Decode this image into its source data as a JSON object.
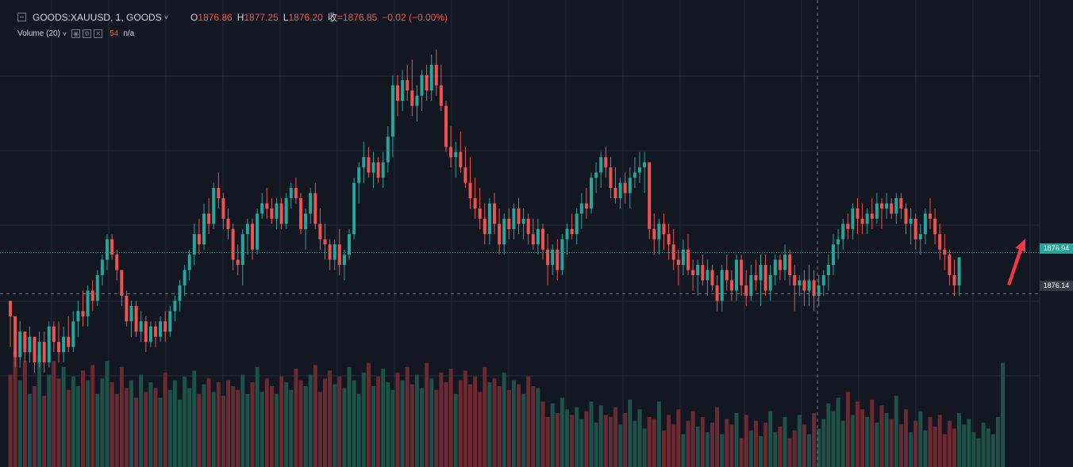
{
  "legend": {
    "symbol": "GOODS:XAUUSD, 1, GOODS",
    "caret": "˅",
    "open_label": "O",
    "open": "1876.86",
    "high_label": "H",
    "high": "1877.25",
    "low_label": "L",
    "low": "1876.20",
    "close_label": "收",
    "close": "=1876.85",
    "change": "−0.02 (−0.00%)",
    "volume_label": "Volume (20)",
    "volume_value": "54",
    "volume_ma": "n/a"
  },
  "price_axis": {
    "last_price": "1876.94",
    "crosshair_price": "1876.14"
  },
  "colors": {
    "background": "#131722",
    "up": "#26a69a",
    "down": "#ef5350",
    "grid": "#2a2e39",
    "arrow": "#f23645"
  },
  "chart_data": {
    "type": "candlestick",
    "symbol": "GOODS:XAUUSD",
    "interval": "1",
    "ylim": [
      1874.6,
      1881.4
    ],
    "volume_ylim": [
      0,
      70
    ],
    "last_price": 1876.94,
    "crosshair_price": 1876.14,
    "candles": [
      [
        1876.0,
        1876.0,
        1875.1,
        1875.7
      ],
      [
        1875.7,
        1875.7,
        1874.7,
        1874.9
      ],
      [
        1874.9,
        1875.6,
        1874.7,
        1875.4
      ],
      [
        1875.4,
        1875.4,
        1874.8,
        1875.0
      ],
      [
        1875.0,
        1875.5,
        1874.8,
        1875.3
      ],
      [
        1875.3,
        1875.3,
        1874.6,
        1874.8
      ],
      [
        1874.8,
        1875.4,
        1874.7,
        1875.2
      ],
      [
        1875.2,
        1875.4,
        1874.6,
        1874.8
      ],
      [
        1874.8,
        1875.6,
        1874.7,
        1875.5
      ],
      [
        1875.5,
        1875.6,
        1875.0,
        1875.2
      ],
      [
        1875.2,
        1875.6,
        1874.8,
        1875.0
      ],
      [
        1875.0,
        1875.5,
        1874.8,
        1875.3
      ],
      [
        1875.3,
        1875.7,
        1875.0,
        1875.1
      ],
      [
        1875.1,
        1875.8,
        1875.0,
        1875.6
      ],
      [
        1875.6,
        1876.0,
        1875.3,
        1875.8
      ],
      [
        1875.8,
        1876.2,
        1875.5,
        1875.7
      ],
      [
        1875.7,
        1876.3,
        1875.5,
        1876.2
      ],
      [
        1876.2,
        1876.4,
        1875.8,
        1876.0
      ],
      [
        1876.0,
        1876.6,
        1875.9,
        1876.5
      ],
      [
        1876.5,
        1876.9,
        1876.3,
        1876.8
      ],
      [
        1876.8,
        1877.3,
        1876.6,
        1877.2
      ],
      [
        1877.2,
        1877.3,
        1876.8,
        1876.9
      ],
      [
        1876.9,
        1877.0,
        1876.4,
        1876.6
      ],
      [
        1876.6,
        1876.6,
        1875.9,
        1876.1
      ],
      [
        1876.1,
        1876.2,
        1875.5,
        1875.6
      ],
      [
        1875.6,
        1876.0,
        1875.3,
        1875.9
      ],
      [
        1875.9,
        1876.0,
        1875.3,
        1875.4
      ],
      [
        1875.4,
        1875.8,
        1875.2,
        1875.6
      ],
      [
        1875.6,
        1875.7,
        1875.0,
        1875.2
      ],
      [
        1875.2,
        1875.6,
        1875.1,
        1875.5
      ],
      [
        1875.5,
        1875.6,
        1875.1,
        1875.3
      ],
      [
        1875.3,
        1875.7,
        1875.2,
        1875.6
      ],
      [
        1875.6,
        1875.8,
        1875.2,
        1875.4
      ],
      [
        1875.4,
        1875.9,
        1875.3,
        1875.8
      ],
      [
        1875.8,
        1876.1,
        1875.6,
        1876.0
      ],
      [
        1876.0,
        1876.4,
        1875.8,
        1876.3
      ],
      [
        1876.3,
        1876.7,
        1876.1,
        1876.6
      ],
      [
        1876.6,
        1877.0,
        1876.4,
        1876.9
      ],
      [
        1876.9,
        1877.5,
        1876.7,
        1877.3
      ],
      [
        1877.3,
        1877.6,
        1876.9,
        1877.1
      ],
      [
        1877.1,
        1877.9,
        1877.0,
        1877.7
      ],
      [
        1877.7,
        1878.0,
        1877.3,
        1877.5
      ],
      [
        1877.5,
        1878.3,
        1877.4,
        1878.2
      ],
      [
        1878.2,
        1878.5,
        1877.8,
        1878.0
      ],
      [
        1878.0,
        1878.1,
        1877.4,
        1877.6
      ],
      [
        1877.6,
        1877.8,
        1877.2,
        1877.4
      ],
      [
        1877.4,
        1877.5,
        1876.6,
        1876.8
      ],
      [
        1876.8,
        1877.1,
        1876.5,
        1876.7
      ],
      [
        1876.7,
        1877.4,
        1876.3,
        1877.3
      ],
      [
        1877.3,
        1877.6,
        1876.9,
        1877.5
      ],
      [
        1877.5,
        1877.6,
        1876.8,
        1877.0
      ],
      [
        1877.0,
        1877.8,
        1876.9,
        1877.7
      ],
      [
        1877.7,
        1878.1,
        1877.6,
        1877.9
      ],
      [
        1877.9,
        1878.2,
        1877.6,
        1877.8
      ],
      [
        1877.8,
        1878.0,
        1877.5,
        1877.6
      ],
      [
        1877.6,
        1878.0,
        1877.4,
        1877.9
      ],
      [
        1877.9,
        1878.0,
        1877.4,
        1877.5
      ],
      [
        1877.5,
        1878.1,
        1877.4,
        1878.0
      ],
      [
        1878.0,
        1878.3,
        1877.8,
        1878.2
      ],
      [
        1878.2,
        1878.4,
        1877.9,
        1878.0
      ],
      [
        1878.0,
        1878.1,
        1877.3,
        1877.4
      ],
      [
        1877.4,
        1877.8,
        1877.0,
        1877.7
      ],
      [
        1877.7,
        1878.2,
        1877.5,
        1878.1
      ],
      [
        1878.1,
        1878.3,
        1877.4,
        1877.5
      ],
      [
        1877.5,
        1877.8,
        1877.0,
        1877.2
      ],
      [
        1877.2,
        1877.5,
        1876.8,
        1877.1
      ],
      [
        1877.1,
        1877.2,
        1876.6,
        1876.8
      ],
      [
        1876.8,
        1877.2,
        1876.6,
        1877.1
      ],
      [
        1877.1,
        1877.4,
        1876.5,
        1876.7
      ],
      [
        1876.7,
        1877.0,
        1876.4,
        1876.9
      ],
      [
        1876.9,
        1877.4,
        1876.8,
        1877.3
      ],
      [
        1877.3,
        1878.4,
        1877.2,
        1878.3
      ],
      [
        1878.3,
        1878.7,
        1877.9,
        1878.6
      ],
      [
        1878.6,
        1879.1,
        1878.3,
        1878.8
      ],
      [
        1878.8,
        1879.0,
        1878.4,
        1878.5
      ],
      [
        1878.5,
        1878.9,
        1878.2,
        1878.7
      ],
      [
        1878.7,
        1878.8,
        1878.3,
        1878.4
      ],
      [
        1878.4,
        1878.9,
        1878.2,
        1878.7
      ],
      [
        1878.7,
        1879.4,
        1878.5,
        1879.2
      ],
      [
        1879.2,
        1880.4,
        1878.8,
        1880.2
      ],
      [
        1880.2,
        1880.4,
        1879.6,
        1879.9
      ],
      [
        1879.9,
        1880.5,
        1879.7,
        1880.3
      ],
      [
        1880.3,
        1880.6,
        1879.9,
        1880.1
      ],
      [
        1880.1,
        1880.7,
        1879.6,
        1879.8
      ],
      [
        1879.8,
        1880.2,
        1879.5,
        1880.0
      ],
      [
        1880.0,
        1880.5,
        1879.7,
        1880.4
      ],
      [
        1880.4,
        1880.6,
        1879.9,
        1880.1
      ],
      [
        1880.1,
        1880.8,
        1879.9,
        1880.6
      ],
      [
        1880.6,
        1880.9,
        1880.0,
        1880.2
      ],
      [
        1880.2,
        1880.6,
        1879.7,
        1879.8
      ],
      [
        1879.8,
        1879.9,
        1878.9,
        1879.0
      ],
      [
        1879.0,
        1879.4,
        1878.6,
        1878.8
      ],
      [
        1878.8,
        1879.1,
        1878.4,
        1878.9
      ],
      [
        1878.9,
        1879.3,
        1878.5,
        1878.6
      ],
      [
        1878.6,
        1879.0,
        1878.2,
        1878.3
      ],
      [
        1878.3,
        1878.8,
        1877.8,
        1878.0
      ],
      [
        1878.0,
        1878.4,
        1877.6,
        1877.8
      ],
      [
        1877.8,
        1878.2,
        1877.4,
        1877.6
      ],
      [
        1877.6,
        1877.9,
        1877.1,
        1877.3
      ],
      [
        1877.3,
        1878.0,
        1877.1,
        1877.9
      ],
      [
        1877.9,
        1878.1,
        1877.3,
        1877.5
      ],
      [
        1877.5,
        1877.8,
        1876.9,
        1877.1
      ],
      [
        1877.1,
        1877.7,
        1876.9,
        1877.6
      ],
      [
        1877.6,
        1877.8,
        1877.2,
        1877.4
      ],
      [
        1877.4,
        1877.9,
        1877.2,
        1877.8
      ],
      [
        1877.8,
        1878.0,
        1877.3,
        1877.5
      ],
      [
        1877.5,
        1877.8,
        1877.2,
        1877.6
      ],
      [
        1877.6,
        1877.7,
        1877.1,
        1877.3
      ],
      [
        1877.3,
        1877.6,
        1877.0,
        1877.1
      ],
      [
        1877.1,
        1877.6,
        1876.9,
        1877.4
      ],
      [
        1877.4,
        1877.5,
        1876.8,
        1877.0
      ],
      [
        1877.0,
        1877.3,
        1876.3,
        1876.7
      ],
      [
        1876.7,
        1877.1,
        1876.5,
        1877.0
      ],
      [
        1877.0,
        1877.2,
        1876.4,
        1876.6
      ],
      [
        1876.6,
        1877.3,
        1876.5,
        1877.2
      ],
      [
        1877.2,
        1877.5,
        1876.9,
        1877.4
      ],
      [
        1877.4,
        1877.7,
        1877.2,
        1877.3
      ],
      [
        1877.3,
        1877.8,
        1877.1,
        1877.7
      ],
      [
        1877.7,
        1878.1,
        1877.4,
        1877.9
      ],
      [
        1877.9,
        1878.2,
        1877.6,
        1877.8
      ],
      [
        1877.8,
        1878.5,
        1877.7,
        1878.4
      ],
      [
        1878.4,
        1878.7,
        1878.1,
        1878.5
      ],
      [
        1878.5,
        1878.9,
        1878.2,
        1878.8
      ],
      [
        1878.8,
        1879.0,
        1878.4,
        1878.6
      ],
      [
        1878.6,
        1878.8,
        1878.0,
        1878.2
      ],
      [
        1878.2,
        1878.6,
        1877.9,
        1878.0
      ],
      [
        1878.0,
        1878.4,
        1877.8,
        1878.3
      ],
      [
        1878.3,
        1878.5,
        1877.9,
        1878.1
      ],
      [
        1878.1,
        1878.6,
        1877.8,
        1878.4
      ],
      [
        1878.4,
        1878.8,
        1878.2,
        1878.5
      ],
      [
        1878.5,
        1878.9,
        1878.3,
        1878.6
      ],
      [
        1878.6,
        1878.9,
        1878.1,
        1878.7
      ],
      [
        1878.7,
        1878.7,
        1877.2,
        1877.4
      ],
      [
        1877.4,
        1877.7,
        1876.9,
        1877.2
      ],
      [
        1877.2,
        1877.6,
        1876.9,
        1877.5
      ],
      [
        1877.5,
        1877.7,
        1877.0,
        1877.3
      ],
      [
        1877.3,
        1877.5,
        1876.8,
        1877.1
      ],
      [
        1877.1,
        1877.4,
        1876.6,
        1876.8
      ],
      [
        1876.8,
        1877.0,
        1876.3,
        1876.7
      ],
      [
        1876.7,
        1877.2,
        1876.5,
        1877.0
      ],
      [
        1877.0,
        1877.3,
        1876.5,
        1876.6
      ],
      [
        1876.6,
        1876.8,
        1876.2,
        1876.5
      ],
      [
        1876.5,
        1876.8,
        1876.1,
        1876.7
      ],
      [
        1876.7,
        1876.9,
        1876.3,
        1876.4
      ],
      [
        1876.4,
        1876.8,
        1876.1,
        1876.6
      ],
      [
        1876.6,
        1876.7,
        1876.2,
        1876.3
      ],
      [
        1876.3,
        1876.5,
        1875.8,
        1876.0
      ],
      [
        1876.0,
        1876.7,
        1875.8,
        1876.6
      ],
      [
        1876.6,
        1876.9,
        1876.2,
        1876.4
      ],
      [
        1876.4,
        1876.6,
        1876.0,
        1876.2
      ],
      [
        1876.2,
        1876.9,
        1876.0,
        1876.8
      ],
      [
        1876.8,
        1876.9,
        1876.1,
        1876.3
      ],
      [
        1876.3,
        1876.6,
        1875.9,
        1876.1
      ],
      [
        1876.1,
        1876.7,
        1876.0,
        1876.5
      ],
      [
        1876.5,
        1876.8,
        1876.2,
        1876.4
      ],
      [
        1876.4,
        1876.9,
        1875.9,
        1876.7
      ],
      [
        1876.7,
        1876.9,
        1876.1,
        1876.2
      ],
      [
        1876.2,
        1876.7,
        1876.0,
        1876.5
      ],
      [
        1876.5,
        1876.9,
        1876.3,
        1876.8
      ],
      [
        1876.8,
        1876.9,
        1876.4,
        1876.6
      ],
      [
        1876.6,
        1877.1,
        1876.4,
        1876.9
      ],
      [
        1876.9,
        1877.0,
        1876.3,
        1876.5
      ],
      [
        1876.5,
        1876.7,
        1875.8,
        1876.3
      ],
      [
        1876.3,
        1876.5,
        1876.1,
        1876.4
      ],
      [
        1876.4,
        1876.6,
        1875.9,
        1876.2
      ],
      [
        1876.2,
        1876.7,
        1875.9,
        1876.4
      ],
      [
        1876.4,
        1876.6,
        1875.8,
        1876.1
      ],
      [
        1876.1,
        1876.5,
        1875.9,
        1876.3
      ],
      [
        1876.3,
        1876.6,
        1876.1,
        1876.5
      ],
      [
        1876.5,
        1876.9,
        1876.2,
        1876.7
      ],
      [
        1876.7,
        1877.3,
        1876.5,
        1877.1
      ],
      [
        1877.1,
        1877.4,
        1876.8,
        1877.2
      ],
      [
        1877.2,
        1877.6,
        1877.0,
        1877.5
      ],
      [
        1877.5,
        1877.7,
        1877.2,
        1877.4
      ],
      [
        1877.4,
        1877.9,
        1877.2,
        1877.8
      ],
      [
        1877.8,
        1878.0,
        1877.3,
        1877.6
      ],
      [
        1877.6,
        1877.9,
        1877.3,
        1877.5
      ],
      [
        1877.5,
        1877.8,
        1877.3,
        1877.7
      ],
      [
        1877.7,
        1878.0,
        1877.4,
        1877.6
      ],
      [
        1877.6,
        1878.1,
        1877.5,
        1877.9
      ],
      [
        1877.9,
        1878.0,
        1877.4,
        1877.8
      ],
      [
        1877.8,
        1878.1,
        1877.6,
        1877.9
      ],
      [
        1877.9,
        1878.0,
        1877.6,
        1877.7
      ],
      [
        1877.7,
        1878.1,
        1877.5,
        1878.0
      ],
      [
        1878.0,
        1878.1,
        1877.6,
        1877.8
      ],
      [
        1877.8,
        1877.9,
        1877.3,
        1877.5
      ],
      [
        1877.5,
        1877.8,
        1877.1,
        1877.6
      ],
      [
        1877.6,
        1877.7,
        1877.0,
        1877.2
      ],
      [
        1877.2,
        1877.5,
        1876.9,
        1877.3
      ],
      [
        1877.3,
        1877.8,
        1877.1,
        1877.7
      ],
      [
        1877.7,
        1878.0,
        1877.4,
        1877.6
      ],
      [
        1877.6,
        1877.8,
        1877.1,
        1877.3
      ],
      [
        1877.3,
        1877.5,
        1876.8,
        1877.0
      ],
      [
        1877.0,
        1877.3,
        1876.6,
        1876.9
      ],
      [
        1876.9,
        1877.0,
        1876.3,
        1876.5
      ],
      [
        1876.5,
        1876.8,
        1876.1,
        1876.3
      ],
      [
        1876.3,
        1876.8,
        1876.1,
        1876.85
      ]
    ],
    "volumes": [
      48,
      60,
      45,
      55,
      38,
      42,
      58,
      37,
      48,
      55,
      46,
      52,
      40,
      47,
      42,
      50,
      45,
      53,
      38,
      46,
      55,
      44,
      38,
      52,
      41,
      45,
      36,
      48,
      39,
      44,
      41,
      36,
      49,
      40,
      45,
      35,
      47,
      41,
      50,
      38,
      43,
      46,
      39,
      44,
      37,
      45,
      42,
      40,
      48,
      38,
      44,
      52,
      39,
      46,
      42,
      38,
      47,
      44,
      40,
      51,
      45,
      42,
      48,
      53,
      39,
      46,
      50,
      43,
      47,
      41,
      52,
      45,
      38,
      49,
      54,
      42,
      47,
      51,
      44,
      40,
      49,
      45,
      52,
      43,
      48,
      41,
      54,
      46,
      40,
      49,
      44,
      51,
      38,
      45,
      50,
      43,
      47,
      39,
      52,
      44,
      46,
      42,
      49,
      40,
      45,
      43,
      38,
      47,
      42,
      41,
      34,
      26,
      33,
      28,
      36,
      30,
      27,
      31,
      25,
      29,
      34,
      23,
      32,
      27,
      26,
      31,
      22,
      28,
      35,
      24,
      30,
      20,
      26,
      25,
      34,
      19,
      27,
      22,
      30,
      17,
      24,
      29,
      21,
      26,
      18,
      23,
      31,
      17,
      25,
      22,
      28,
      15,
      27,
      19,
      24,
      16,
      23,
      29,
      18,
      21,
      26,
      15,
      19,
      27,
      22,
      17,
      28,
      20,
      25,
      33,
      29,
      36,
      24,
      39,
      27,
      34,
      30,
      26,
      35,
      23,
      32,
      28,
      25,
      37,
      22,
      30,
      18,
      24,
      29,
      19,
      26,
      21,
      27,
      17,
      24,
      20,
      28,
      22,
      25,
      18,
      15,
      23,
      20,
      17,
      26,
      54
    ]
  }
}
